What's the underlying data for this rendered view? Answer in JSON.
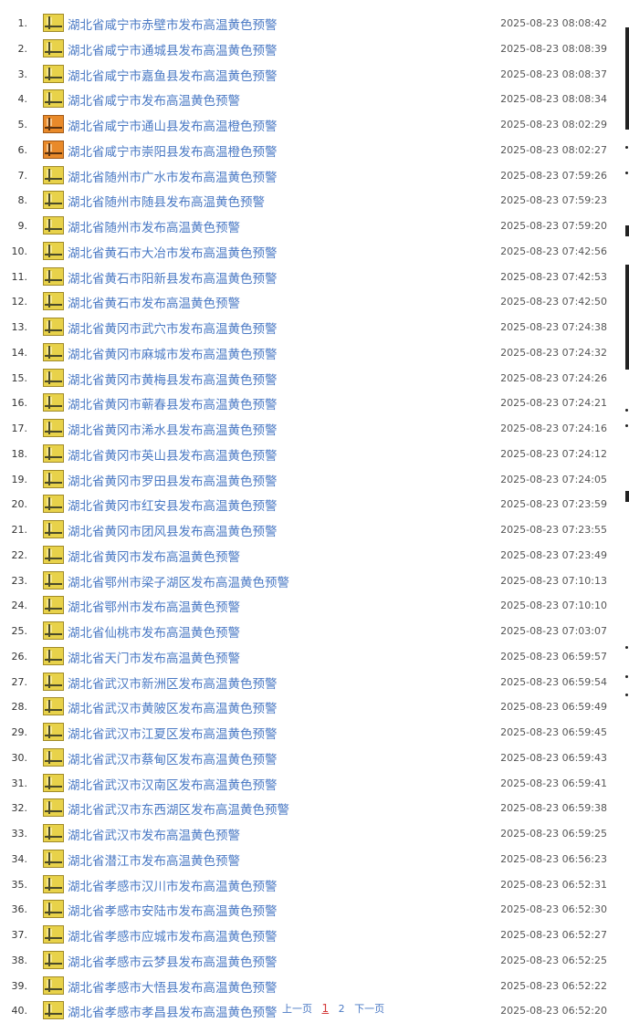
{
  "alerts": [
    {
      "index": "1.",
      "title": "湖北省咸宁市赤壁市发布高温黄色预警",
      "time": "2025-08-23 08:08:42",
      "level": "yellow",
      "icon": "heat-yellow-warning-icon"
    },
    {
      "index": "2.",
      "title": "湖北省咸宁市通城县发布高温黄色预警",
      "time": "2025-08-23 08:08:39",
      "level": "yellow",
      "icon": "heat-yellow-warning-icon"
    },
    {
      "index": "3.",
      "title": "湖北省咸宁市嘉鱼县发布高温黄色预警",
      "time": "2025-08-23 08:08:37",
      "level": "yellow",
      "icon": "heat-yellow-warning-icon"
    },
    {
      "index": "4.",
      "title": "湖北省咸宁市发布高温黄色预警",
      "time": "2025-08-23 08:08:34",
      "level": "yellow",
      "icon": "heat-yellow-warning-icon"
    },
    {
      "index": "5.",
      "title": "湖北省咸宁市通山县发布高温橙色预警",
      "time": "2025-08-23 08:02:29",
      "level": "orange",
      "icon": "heat-orange-warning-icon"
    },
    {
      "index": "6.",
      "title": "湖北省咸宁市崇阳县发布高温橙色预警",
      "time": "2025-08-23 08:02:27",
      "level": "orange",
      "icon": "heat-orange-warning-icon"
    },
    {
      "index": "7.",
      "title": "湖北省随州市广水市发布高温黄色预警",
      "time": "2025-08-23 07:59:26",
      "level": "yellow",
      "icon": "heat-yellow-warning-icon"
    },
    {
      "index": "8.",
      "title": "湖北省随州市随县发布高温黄色预警",
      "time": "2025-08-23 07:59:23",
      "level": "yellow",
      "icon": "heat-yellow-warning-icon"
    },
    {
      "index": "9.",
      "title": "湖北省随州市发布高温黄色预警",
      "time": "2025-08-23 07:59:20",
      "level": "yellow",
      "icon": "heat-yellow-warning-icon"
    },
    {
      "index": "10.",
      "title": "湖北省黄石市大冶市发布高温黄色预警",
      "time": "2025-08-23 07:42:56",
      "level": "yellow",
      "icon": "heat-yellow-warning-icon"
    },
    {
      "index": "11.",
      "title": "湖北省黄石市阳新县发布高温黄色预警",
      "time": "2025-08-23 07:42:53",
      "level": "yellow",
      "icon": "heat-yellow-warning-icon"
    },
    {
      "index": "12.",
      "title": "湖北省黄石市发布高温黄色预警",
      "time": "2025-08-23 07:42:50",
      "level": "yellow",
      "icon": "heat-yellow-warning-icon"
    },
    {
      "index": "13.",
      "title": "湖北省黄冈市武穴市发布高温黄色预警",
      "time": "2025-08-23 07:24:38",
      "level": "yellow",
      "icon": "heat-yellow-warning-icon"
    },
    {
      "index": "14.",
      "title": "湖北省黄冈市麻城市发布高温黄色预警",
      "time": "2025-08-23 07:24:32",
      "level": "yellow",
      "icon": "heat-yellow-warning-icon"
    },
    {
      "index": "15.",
      "title": "湖北省黄冈市黄梅县发布高温黄色预警",
      "time": "2025-08-23 07:24:26",
      "level": "yellow",
      "icon": "heat-yellow-warning-icon"
    },
    {
      "index": "16.",
      "title": "湖北省黄冈市蕲春县发布高温黄色预警",
      "time": "2025-08-23 07:24:21",
      "level": "yellow",
      "icon": "heat-yellow-warning-icon"
    },
    {
      "index": "17.",
      "title": "湖北省黄冈市浠水县发布高温黄色预警",
      "time": "2025-08-23 07:24:16",
      "level": "yellow",
      "icon": "heat-yellow-warning-icon"
    },
    {
      "index": "18.",
      "title": "湖北省黄冈市英山县发布高温黄色预警",
      "time": "2025-08-23 07:24:12",
      "level": "yellow",
      "icon": "heat-yellow-warning-icon"
    },
    {
      "index": "19.",
      "title": "湖北省黄冈市罗田县发布高温黄色预警",
      "time": "2025-08-23 07:24:05",
      "level": "yellow",
      "icon": "heat-yellow-warning-icon"
    },
    {
      "index": "20.",
      "title": "湖北省黄冈市红安县发布高温黄色预警",
      "time": "2025-08-23 07:23:59",
      "level": "yellow",
      "icon": "heat-yellow-warning-icon"
    },
    {
      "index": "21.",
      "title": "湖北省黄冈市团风县发布高温黄色预警",
      "time": "2025-08-23 07:23:55",
      "level": "yellow",
      "icon": "heat-yellow-warning-icon"
    },
    {
      "index": "22.",
      "title": "湖北省黄冈市发布高温黄色预警",
      "time": "2025-08-23 07:23:49",
      "level": "yellow",
      "icon": "heat-yellow-warning-icon"
    },
    {
      "index": "23.",
      "title": "湖北省鄂州市梁子湖区发布高温黄色预警",
      "time": "2025-08-23 07:10:13",
      "level": "yellow",
      "icon": "heat-yellow-warning-icon"
    },
    {
      "index": "24.",
      "title": "湖北省鄂州市发布高温黄色预警",
      "time": "2025-08-23 07:10:10",
      "level": "yellow",
      "icon": "heat-yellow-warning-icon"
    },
    {
      "index": "25.",
      "title": "湖北省仙桃市发布高温黄色预警",
      "time": "2025-08-23 07:03:07",
      "level": "yellow",
      "icon": "heat-yellow-warning-icon"
    },
    {
      "index": "26.",
      "title": "湖北省天门市发布高温黄色预警",
      "time": "2025-08-23 06:59:57",
      "level": "yellow",
      "icon": "heat-yellow-warning-icon"
    },
    {
      "index": "27.",
      "title": "湖北省武汉市新洲区发布高温黄色预警",
      "time": "2025-08-23 06:59:54",
      "level": "yellow",
      "icon": "heat-yellow-warning-icon"
    },
    {
      "index": "28.",
      "title": "湖北省武汉市黄陂区发布高温黄色预警",
      "time": "2025-08-23 06:59:49",
      "level": "yellow",
      "icon": "heat-yellow-warning-icon"
    },
    {
      "index": "29.",
      "title": "湖北省武汉市江夏区发布高温黄色预警",
      "time": "2025-08-23 06:59:45",
      "level": "yellow",
      "icon": "heat-yellow-warning-icon"
    },
    {
      "index": "30.",
      "title": "湖北省武汉市蔡甸区发布高温黄色预警",
      "time": "2025-08-23 06:59:43",
      "level": "yellow",
      "icon": "heat-yellow-warning-icon"
    },
    {
      "index": "31.",
      "title": "湖北省武汉市汉南区发布高温黄色预警",
      "time": "2025-08-23 06:59:41",
      "level": "yellow",
      "icon": "heat-yellow-warning-icon"
    },
    {
      "index": "32.",
      "title": "湖北省武汉市东西湖区发布高温黄色预警",
      "time": "2025-08-23 06:59:38",
      "level": "yellow",
      "icon": "heat-yellow-warning-icon"
    },
    {
      "index": "33.",
      "title": "湖北省武汉市发布高温黄色预警",
      "time": "2025-08-23 06:59:25",
      "level": "yellow",
      "icon": "heat-yellow-warning-icon"
    },
    {
      "index": "34.",
      "title": "湖北省潜江市发布高温黄色预警",
      "time": "2025-08-23 06:56:23",
      "level": "yellow",
      "icon": "heat-yellow-warning-icon"
    },
    {
      "index": "35.",
      "title": "湖北省孝感市汉川市发布高温黄色预警",
      "time": "2025-08-23 06:52:31",
      "level": "yellow",
      "icon": "heat-yellow-warning-icon"
    },
    {
      "index": "36.",
      "title": "湖北省孝感市安陆市发布高温黄色预警",
      "time": "2025-08-23 06:52:30",
      "level": "yellow",
      "icon": "heat-yellow-warning-icon"
    },
    {
      "index": "37.",
      "title": "湖北省孝感市应城市发布高温黄色预警",
      "time": "2025-08-23 06:52:27",
      "level": "yellow",
      "icon": "heat-yellow-warning-icon"
    },
    {
      "index": "38.",
      "title": "湖北省孝感市云梦县发布高温黄色预警",
      "time": "2025-08-23 06:52:25",
      "level": "yellow",
      "icon": "heat-yellow-warning-icon"
    },
    {
      "index": "39.",
      "title": "湖北省孝感市大悟县发布高温黄色预警",
      "time": "2025-08-23 06:52:22",
      "level": "yellow",
      "icon": "heat-yellow-warning-icon"
    },
    {
      "index": "40.",
      "title": "湖北省孝感市孝昌县发布高温黄色预警",
      "time": "2025-08-23 06:52:20",
      "level": "yellow",
      "icon": "heat-yellow-warning-icon"
    }
  ],
  "pagination": {
    "prev_label": "上一页",
    "pages": [
      "1",
      "2"
    ],
    "current_page": "1",
    "next_label": "下一页"
  },
  "colors": {
    "link": "#4a79c4",
    "current_page": "#d43a3a",
    "yellow_icon": "#e8d24a",
    "orange_icon": "#e98a2a"
  }
}
